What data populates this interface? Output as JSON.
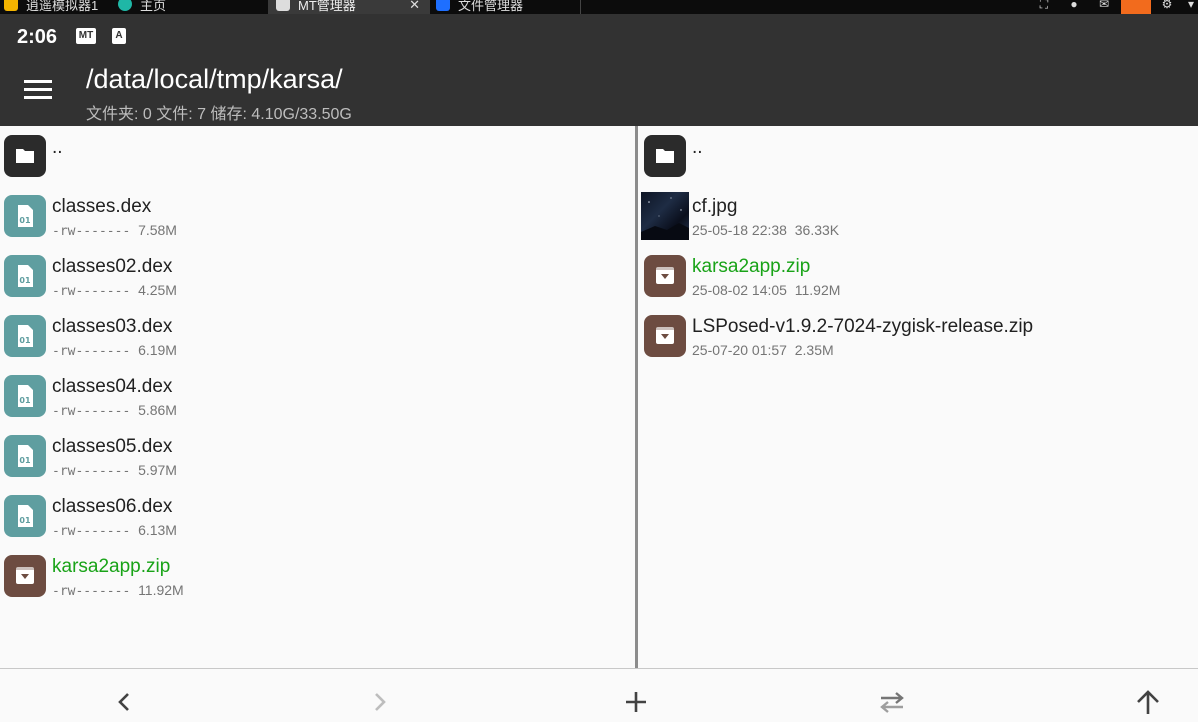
{
  "emulator_tabs": [
    {
      "label": "逍遥模拟器1",
      "color": "#f4b400"
    },
    {
      "label": "主页",
      "color": "#1fb7a6"
    },
    {
      "label": "MT管理器",
      "color": "#dddddd",
      "close": "✕"
    },
    {
      "label": "文件管理器",
      "color": "#1e6fff"
    }
  ],
  "status_bar": {
    "time": "2:06",
    "icons": [
      {
        "name": "mt-notification-icon",
        "text": "MT"
      },
      {
        "name": "a-notification-icon",
        "text": "A"
      }
    ]
  },
  "toolbar": {
    "path": "/data/local/tmp/karsa/",
    "summary": "文件夹: 0  文件: 7  储存: 4.10G/33.50G"
  },
  "left_pane": {
    "parent": "..",
    "files": [
      {
        "name": "classes.dex",
        "perm": "-rw-------",
        "size": "7.58M",
        "type": "dex",
        "highlight": false
      },
      {
        "name": "classes02.dex",
        "perm": "-rw-------",
        "size": "4.25M",
        "type": "dex",
        "highlight": false
      },
      {
        "name": "classes03.dex",
        "perm": "-rw-------",
        "size": "6.19M",
        "type": "dex",
        "highlight": false
      },
      {
        "name": "classes04.dex",
        "perm": "-rw-------",
        "size": "5.86M",
        "type": "dex",
        "highlight": false
      },
      {
        "name": "classes05.dex",
        "perm": "-rw-------",
        "size": "5.97M",
        "type": "dex",
        "highlight": false
      },
      {
        "name": "classes06.dex",
        "perm": "-rw-------",
        "size": "6.13M",
        "type": "dex",
        "highlight": false
      },
      {
        "name": "karsa2app.zip",
        "perm": "-rw-------",
        "size": "11.92M",
        "type": "zip",
        "highlight": true
      }
    ]
  },
  "right_pane": {
    "parent": "..",
    "files": [
      {
        "name": "cf.jpg",
        "date": "25-05-18 22:38",
        "size": "36.33K",
        "type": "image",
        "highlight": false
      },
      {
        "name": "karsa2app.zip",
        "date": "25-08-02 14:05",
        "size": "11.92M",
        "type": "zip",
        "highlight": true
      },
      {
        "name": "LSPosed-v1.9.2-7024-zygisk-release.zip",
        "date": "25-07-20 01:57",
        "size": "2.35M",
        "type": "zip",
        "highlight": false
      }
    ]
  },
  "bottom_bar": [
    "back-button",
    "forward-button",
    "add-button",
    "swap-panes-button",
    "up-button"
  ],
  "dex_icon_text": "01",
  "colors": {
    "appbar": "#323232",
    "dex_icon": "#5f9ea0",
    "zip_icon": "#6d4c41",
    "folder_icon": "#2b2b2b",
    "highlight_name": "#19a318"
  }
}
